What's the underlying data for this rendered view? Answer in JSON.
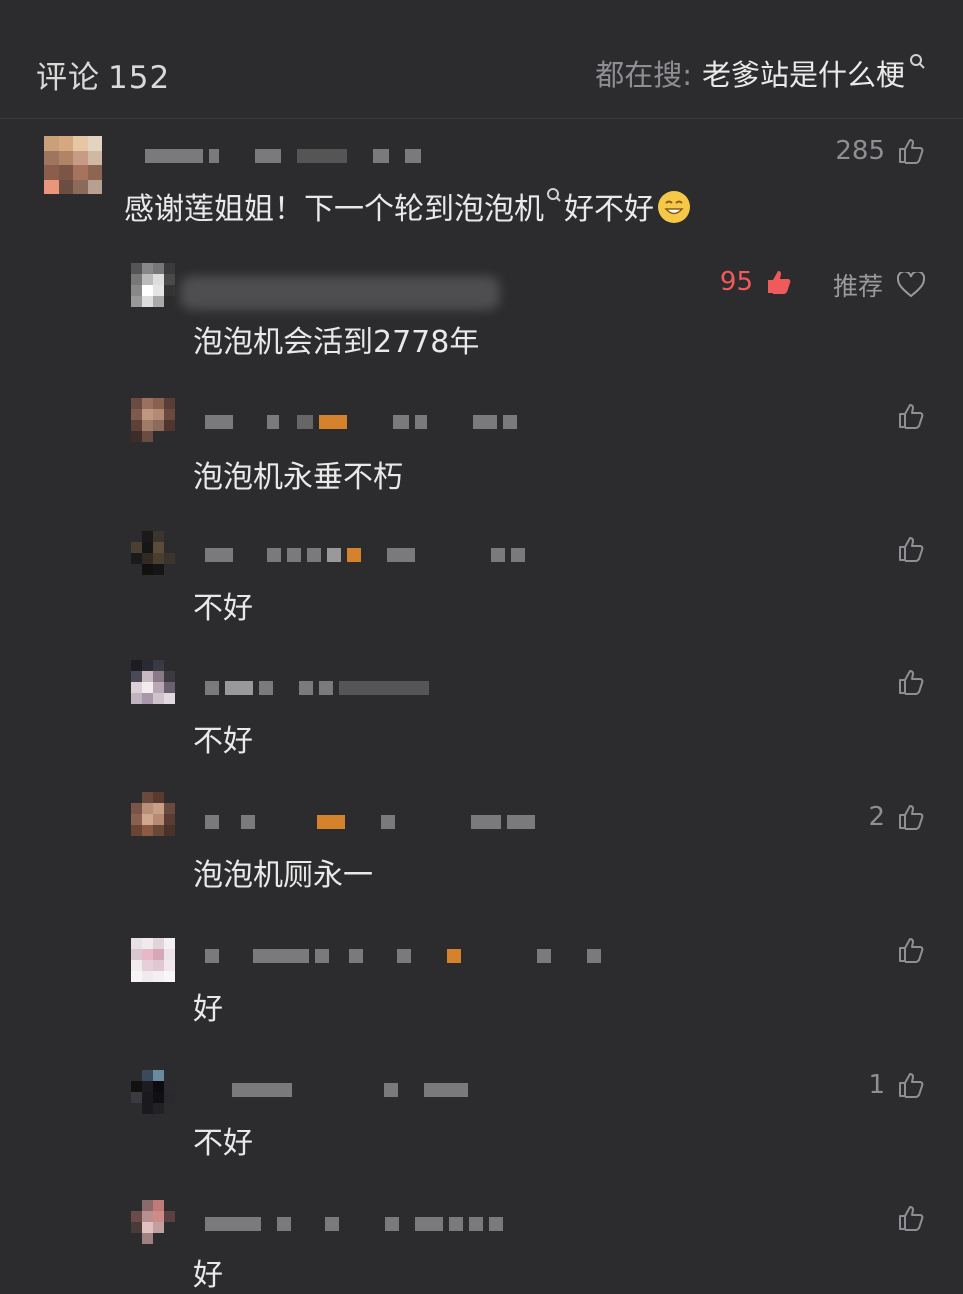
{
  "header": {
    "title": "评论",
    "count": "152",
    "search_label": "都在搜:",
    "search_query": "老爹站是什么梗"
  },
  "comments": [
    {
      "text_a": "感谢莲姐姐！下一个轮到",
      "link": "泡泡机",
      "text_b": "好不好",
      "likes": "285"
    },
    {
      "text": "泡泡机会活到2778年",
      "likes": "95",
      "recommend": "推荐"
    },
    {
      "text": "泡泡机永垂不朽",
      "likes": ""
    },
    {
      "text": "不好",
      "likes": ""
    },
    {
      "text": "不好",
      "likes": ""
    },
    {
      "text": "泡泡机厕永一",
      "likes": "2"
    },
    {
      "text": "好",
      "likes": ""
    },
    {
      "text": "不好",
      "likes": "1"
    },
    {
      "text": "好",
      "likes": ""
    }
  ],
  "colors": {
    "background": "#2c2c2e",
    "hot_like": "#f05a5a",
    "muted": "#8e8e93"
  },
  "icons": [
    "search-icon",
    "thumbs-up-icon",
    "heart-icon",
    "smile-emoji-icon"
  ]
}
